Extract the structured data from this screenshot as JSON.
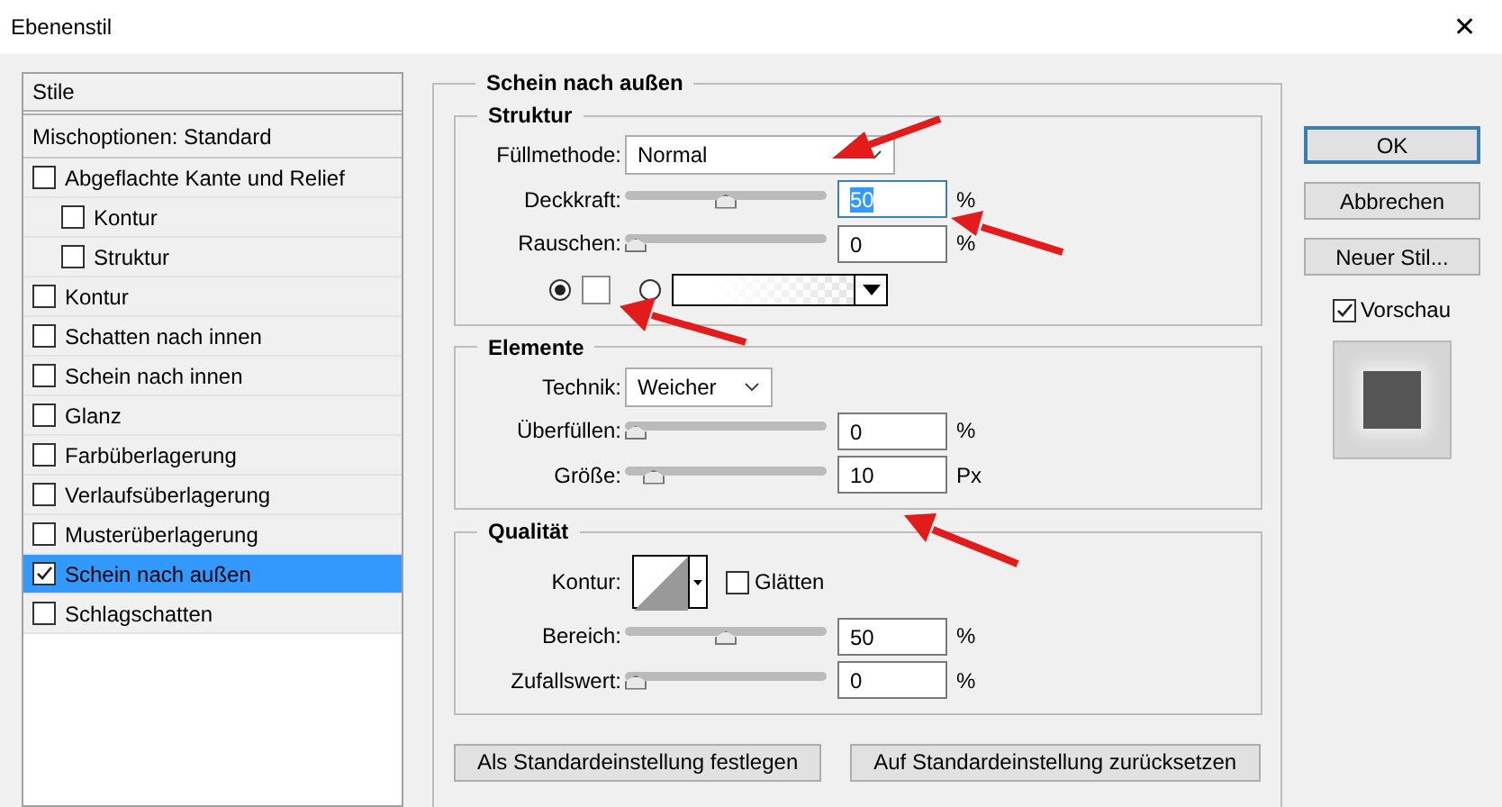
{
  "window": {
    "title": "Ebenenstil",
    "close": "✕"
  },
  "styles": {
    "header": "Stile",
    "items": [
      {
        "label": "Mischoptionen: Standard",
        "kind": "plain",
        "selected": false
      },
      {
        "label": "Abgeflachte Kante und Relief",
        "kind": "check",
        "checked": false,
        "selected": false,
        "children": [
          {
            "label": "Kontur",
            "kind": "check",
            "checked": false,
            "selected": false
          },
          {
            "label": "Struktur",
            "kind": "check",
            "checked": false,
            "selected": false
          }
        ]
      },
      {
        "label": "Kontur",
        "kind": "check",
        "checked": false,
        "selected": false
      },
      {
        "label": "Schatten nach innen",
        "kind": "check",
        "checked": false,
        "selected": false
      },
      {
        "label": "Schein nach innen",
        "kind": "check",
        "checked": false,
        "selected": false
      },
      {
        "label": "Glanz",
        "kind": "check",
        "checked": false,
        "selected": false
      },
      {
        "label": "Farbüberlagerung",
        "kind": "check",
        "checked": false,
        "selected": false
      },
      {
        "label": "Verlaufsüberlagerung",
        "kind": "check",
        "checked": false,
        "selected": false
      },
      {
        "label": "Musterüberlagerung",
        "kind": "check",
        "checked": false,
        "selected": false
      },
      {
        "label": "Schein nach außen",
        "kind": "check",
        "checked": true,
        "selected": true
      },
      {
        "label": "Schlagschatten",
        "kind": "check",
        "checked": false,
        "selected": false
      }
    ]
  },
  "panel": {
    "title": "Schein nach außen",
    "groups": [
      {
        "title": "Struktur",
        "rows": [
          {
            "kind": "select",
            "label": "Füllmethode:",
            "value": "Normal",
            "wide": true
          },
          {
            "kind": "slider",
            "label": "Deckkraft:",
            "level": 0.5,
            "value": "50",
            "unit": "%",
            "highlighted": true
          },
          {
            "kind": "slider",
            "label": "Rauschen:",
            "level": 0,
            "value": "0",
            "unit": "%",
            "highlighted": false
          },
          {
            "kind": "color",
            "color_selected": true,
            "gradient_selected": false
          }
        ]
      },
      {
        "title": "Elemente",
        "rows": [
          {
            "kind": "select",
            "label": "Technik:",
            "value": "Weicher",
            "wide": false
          },
          {
            "kind": "slider",
            "label": "Überfüllen:",
            "level": 0,
            "value": "0",
            "unit": "%",
            "highlighted": false
          },
          {
            "kind": "slider",
            "label": "Größe:",
            "level": 0.1,
            "value": "10",
            "unit": "Px",
            "highlighted": false
          }
        ]
      },
      {
        "title": "Qualität",
        "rows": [
          {
            "kind": "contour",
            "label": "Kontur:",
            "check_label": "Glätten",
            "checked": false
          },
          {
            "kind": "slider",
            "label": "Bereich:",
            "level": 0.5,
            "value": "50",
            "unit": "%",
            "highlighted": false
          },
          {
            "kind": "slider",
            "label": "Zufallswert:",
            "level": 0,
            "value": "0",
            "unit": "%",
            "highlighted": false
          }
        ]
      }
    ],
    "buttons": [
      "Als Standardeinstellung festlegen",
      "Auf Standardeinstellung zurücksetzen"
    ]
  },
  "actions": [
    {
      "label": "OK",
      "default": true
    },
    {
      "label": "Abbrechen",
      "default": false
    },
    {
      "label": "Neuer Stil...",
      "default": false
    }
  ],
  "preview": {
    "label": "Vorschau",
    "checked": true
  }
}
